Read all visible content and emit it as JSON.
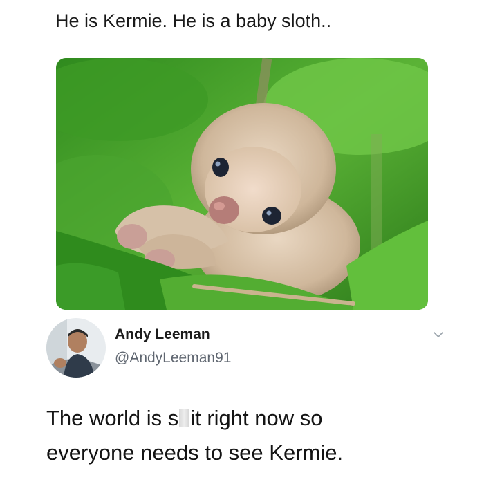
{
  "post": {
    "caption": "He is Kermie. He is a baby sloth..",
    "photo": {
      "subject": "baby sloth on green leaves"
    }
  },
  "tweet": {
    "author_name": "Andy Leeman",
    "author_handle": "@AndyLeeman91",
    "text_parts": [
      "The world is s",
      "it right now so",
      "everyone needs to see Kermie."
    ],
    "icons": {
      "menu": "chevron-down-icon"
    }
  },
  "colors": {
    "background": "#ffffff",
    "handle": "#5f6670",
    "leaf_green": "#3f9a2c"
  }
}
